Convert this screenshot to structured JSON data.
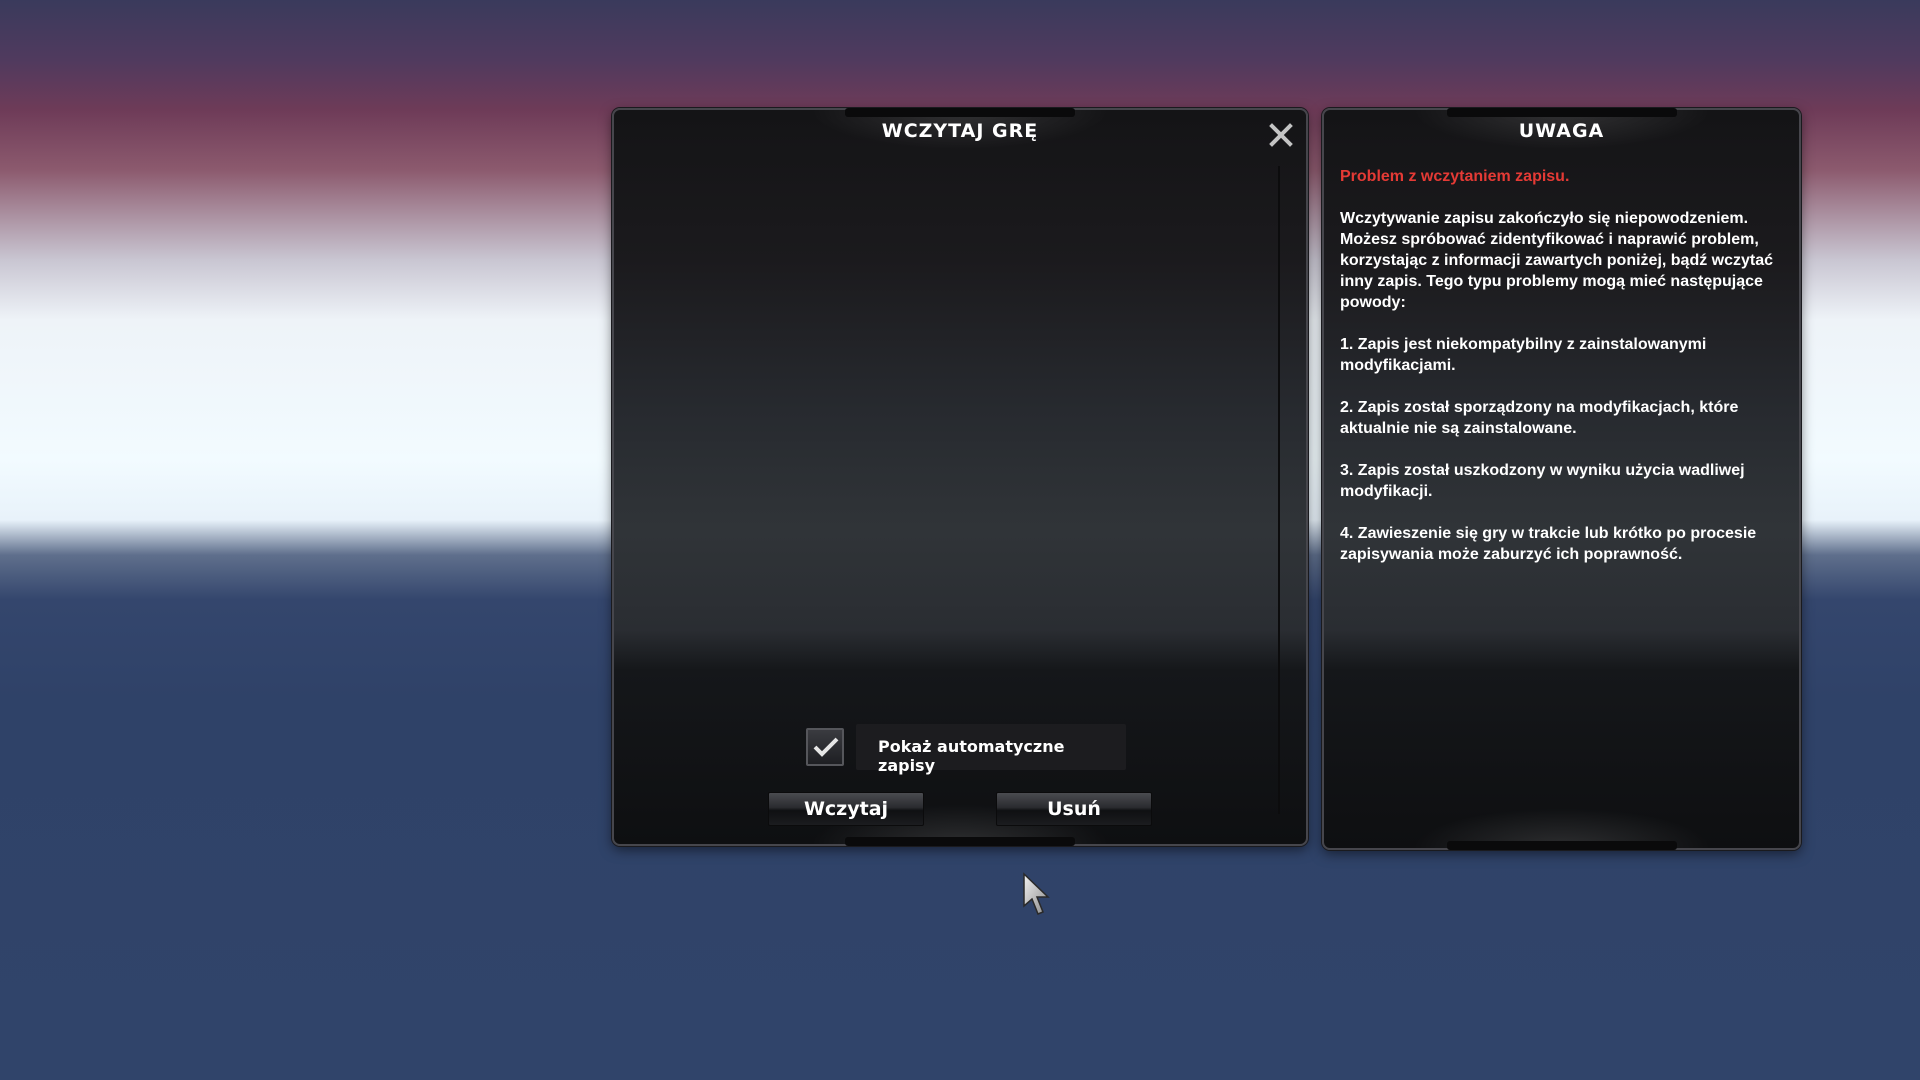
{
  "load_dialog": {
    "title": "WCZYTAJ GRĘ",
    "close_icon": "close-icon",
    "autosave_checkbox": {
      "label": "Pokaż automatyczne zapisy",
      "checked": true
    },
    "buttons": {
      "load_label": "Wczytaj",
      "delete_label": "Usuń"
    }
  },
  "warning_dialog": {
    "title": "UWAGA",
    "headline": "Problem z wczytaniem zapisu.",
    "intro": "Wczytywanie zapisu zakończyło się niepowodzeniem. Możesz spróbować zidentyfikować i naprawić problem, korzystając z informacji zawartych poniżej, bądź wczytać inny zapis. Tego typu problemy mogą mieć następujące powody:",
    "reasons": [
      "1. Zapis jest niekompatybilny z zainstalowanymi modyfikacjami.",
      "2. Zapis został sporządzony na modyfikacjach, które aktualnie nie są zainstalowane.",
      "3. Zapis został uszkodzony w wyniku użycia wadliwej modyfikacji.",
      "4. Zawieszenie się gry w trakcie lub krótko po procesie zapisywania może zaburzyć ich poprawność."
    ],
    "headline_color": "#e53a35"
  }
}
